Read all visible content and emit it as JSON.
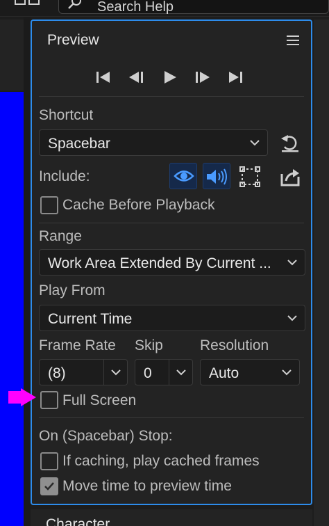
{
  "search": {
    "placeholder": "Search Help"
  },
  "preview": {
    "title": "Preview",
    "shortcut_label": "Shortcut",
    "shortcut_value": "Spacebar",
    "include_label": "Include:",
    "cache_before_playback": {
      "label": "Cache Before Playback",
      "checked": false
    },
    "range_label": "Range",
    "range_value": "Work Area Extended By Current ...",
    "play_from_label": "Play From",
    "play_from_value": "Current Time",
    "frame_rate_label": "Frame Rate",
    "frame_rate_value": "(8)",
    "skip_label": "Skip",
    "skip_value": "0",
    "resolution_label": "Resolution",
    "resolution_value": "Auto",
    "full_screen": {
      "label": "Full Screen",
      "checked": false
    },
    "stop_label": "On (Spacebar) Stop:",
    "if_caching": {
      "label": "If caching, play cached frames",
      "checked": false
    },
    "move_time": {
      "label": "Move time to preview time",
      "checked": true
    }
  },
  "next_panel": {
    "title": "Character"
  },
  "colors": {
    "accent_border": "#2d8ceb",
    "toggle_active_icon": "#4a9bff",
    "annotation_arrow": "#ff00ff",
    "comp_background": "#0000ff"
  },
  "icons": [
    "search-icon",
    "panel-menu-icon",
    "first-frame-icon",
    "previous-frame-icon",
    "play-icon",
    "next-frame-icon",
    "last-frame-icon",
    "reset-icon",
    "video-toggle-icon",
    "audio-toggle-icon",
    "overlays-icon",
    "export-icon",
    "chevron-down-icon",
    "checkmark-icon"
  ]
}
